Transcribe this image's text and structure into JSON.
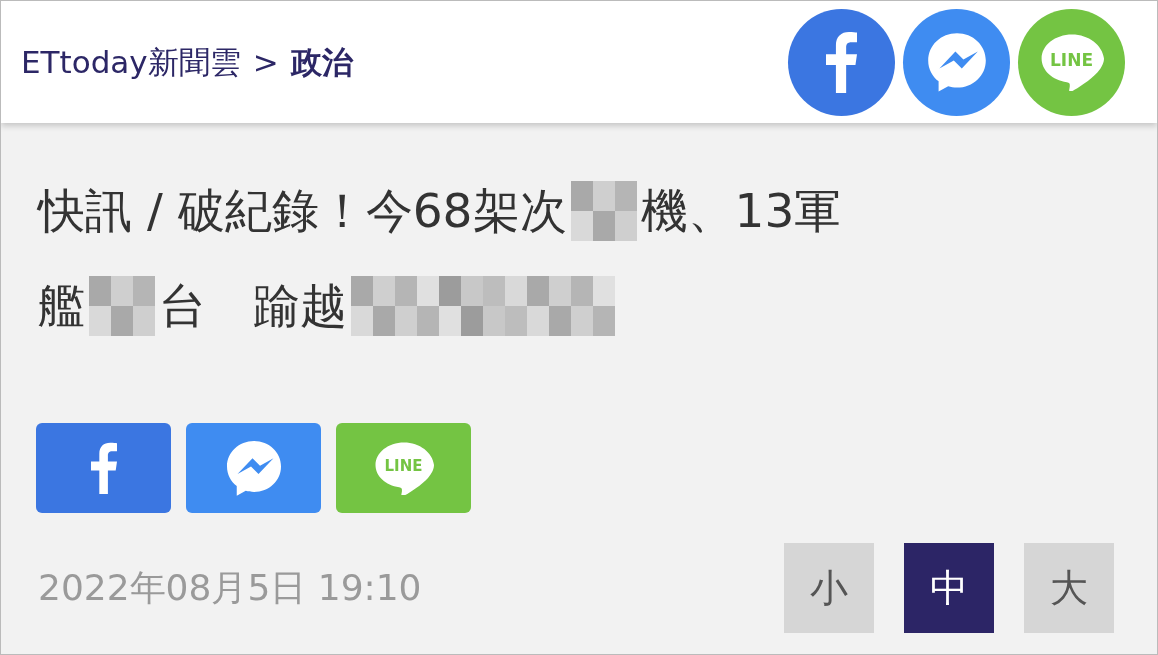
{
  "header": {
    "site": "ETtoday新聞雲",
    "separator": ">",
    "section": "政治",
    "share_icons": [
      {
        "kind": "facebook"
      },
      {
        "kind": "messenger"
      },
      {
        "kind": "line",
        "label": "LINE"
      }
    ]
  },
  "title": {
    "lines": [
      [
        {
          "kind": "text",
          "text": "快訊 / 破紀錄！今68架次"
        },
        {
          "kind": "mosaic-short"
        },
        {
          "kind": "text",
          "text": "機、13軍"
        }
      ],
      [
        {
          "kind": "text",
          "text": "艦"
        },
        {
          "kind": "mosaic-short"
        },
        {
          "kind": "text",
          "text": "台　踰越"
        },
        {
          "kind": "mosaic-long"
        }
      ]
    ]
  },
  "share_buttons": [
    {
      "kind": "facebook"
    },
    {
      "kind": "messenger"
    },
    {
      "kind": "line",
      "label": "LINE"
    }
  ],
  "date": "2022年08月5日 19:10",
  "font_sizes": [
    {
      "label": "小",
      "selected": false
    },
    {
      "label": "中",
      "selected": true
    },
    {
      "label": "大",
      "selected": false
    }
  ]
}
